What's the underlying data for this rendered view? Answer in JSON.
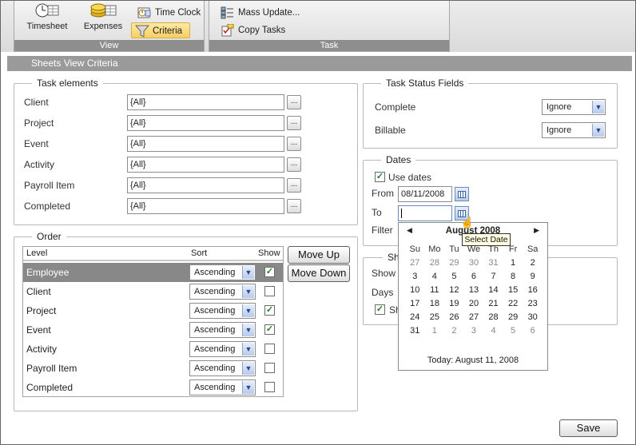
{
  "ribbon": {
    "view_group": {
      "label": "View",
      "timesheet": "Timesheet",
      "expenses": "Expenses",
      "time_clock": "Time Clock",
      "criteria": "Criteria"
    },
    "task_group": {
      "label": "Task",
      "mass_update": "Mass Update...",
      "copy_tasks": "Copy Tasks"
    }
  },
  "title": "Sheets View Criteria",
  "task_elements": {
    "legend": "Task elements",
    "rows": [
      {
        "label": "Client",
        "value": "{All}",
        "button": "..."
      },
      {
        "label": "Project",
        "value": "{All}",
        "button": "..."
      },
      {
        "label": "Event",
        "value": "{All}",
        "button": "..."
      },
      {
        "label": "Activity",
        "value": "{All}",
        "button": "..."
      },
      {
        "label": "Payroll Item",
        "value": "{All}",
        "button": "..."
      },
      {
        "label": "Completed",
        "value": "{All}",
        "button": "..."
      }
    ]
  },
  "order": {
    "legend": "Order",
    "headers": {
      "level": "Level",
      "sort": "Sort",
      "show": "Show"
    },
    "rows": [
      {
        "level": "Employee",
        "sort": "Ascending",
        "show": true,
        "selected": true
      },
      {
        "level": "Client",
        "sort": "Ascending",
        "show": false
      },
      {
        "level": "Project",
        "sort": "Ascending",
        "show": true
      },
      {
        "level": "Event",
        "sort": "Ascending",
        "show": true
      },
      {
        "level": "Activity",
        "sort": "Ascending",
        "show": false
      },
      {
        "level": "Payroll Item",
        "sort": "Ascending",
        "show": false
      },
      {
        "level": "Completed",
        "sort": "Ascending",
        "show": false
      }
    ],
    "move_up": "Move Up",
    "move_down": "Move Down"
  },
  "task_status": {
    "legend": "Task Status Fields",
    "complete_label": "Complete",
    "complete_value": "Ignore",
    "billable_label": "Billable",
    "billable_value": "Ignore"
  },
  "dates": {
    "legend": "Dates",
    "use_dates_label": "Use dates",
    "use_dates": true,
    "from_label": "From",
    "from_value": "08/11/2008",
    "to_label": "To",
    "to_value": "",
    "filter_label": "Filter"
  },
  "show_section": {
    "legend": "Sh",
    "show_label": "Show",
    "days_label": "Days",
    "checkbox_label": "Sh",
    "checked": true
  },
  "calendar": {
    "month": "August 2008",
    "tooltip": "Select Date",
    "weekdays": [
      "Su",
      "Mo",
      "Tu",
      "We",
      "Th",
      "Fr",
      "Sa"
    ],
    "weeks": [
      [
        "27",
        "28",
        "29",
        "30",
        "31",
        "1",
        "2"
      ],
      [
        "3",
        "4",
        "5",
        "6",
        "7",
        "8",
        "9"
      ],
      [
        "10",
        "11",
        "12",
        "13",
        "14",
        "15",
        "16"
      ],
      [
        "17",
        "18",
        "19",
        "20",
        "21",
        "22",
        "23"
      ],
      [
        "24",
        "25",
        "26",
        "27",
        "28",
        "29",
        "30"
      ],
      [
        "31",
        "1",
        "2",
        "3",
        "4",
        "5",
        "6"
      ]
    ],
    "today": "Today: August 11, 2008"
  },
  "save_button": "Save"
}
